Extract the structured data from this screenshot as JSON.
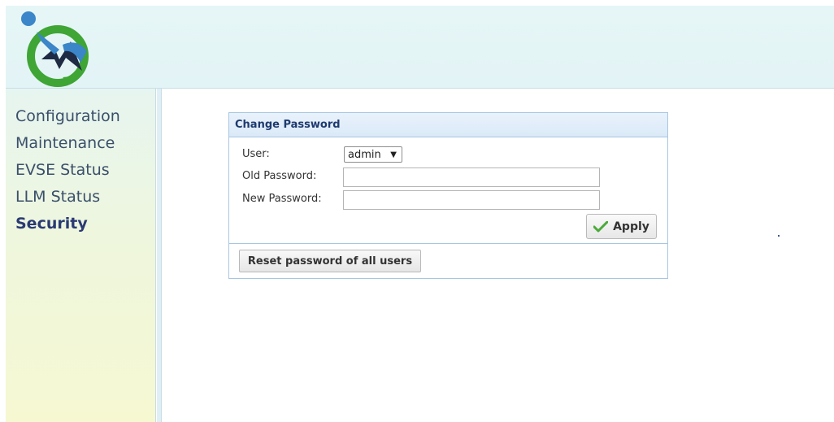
{
  "header": {
    "logo_icon": "charging-logo-icon",
    "colors": {
      "logo_green": "#3fa535",
      "logo_blue": "#3a86c9",
      "logo_dark": "#1f2a44"
    }
  },
  "sidebar": {
    "items": [
      {
        "label": "Configuration",
        "active": false
      },
      {
        "label": "Maintenance",
        "active": false
      },
      {
        "label": "EVSE Status",
        "active": false
      },
      {
        "label": "LLM Status",
        "active": false
      },
      {
        "label": "Security",
        "active": true
      }
    ]
  },
  "change_password": {
    "title": "Change Password",
    "user_label": "User:",
    "user_value": "admin",
    "old_password_label": "Old Password:",
    "old_password_value": "",
    "new_password_label": "New Password:",
    "new_password_value": "",
    "apply_label": "Apply",
    "apply_icon": "check-icon",
    "reset_label": "Reset password of all users"
  },
  "colors": {
    "accent": "#1e3a6e",
    "panel_border": "#a8c6e2",
    "check_green": "#4caa3a"
  }
}
